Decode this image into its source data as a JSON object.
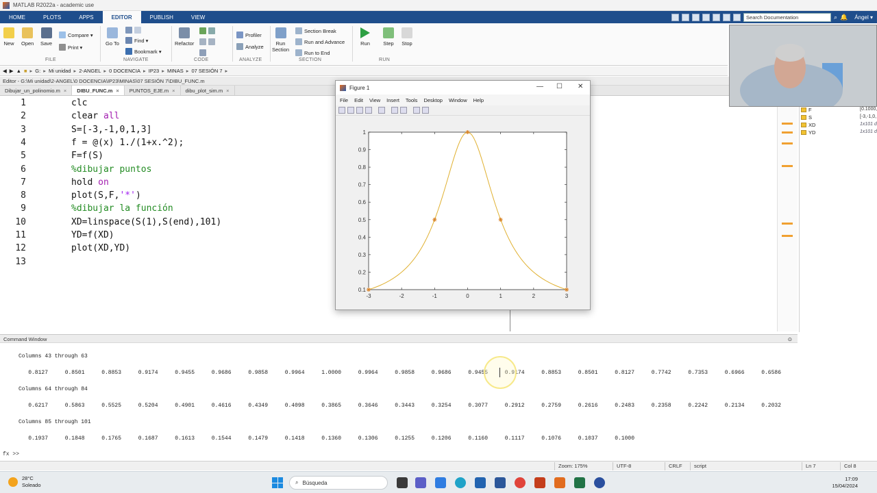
{
  "window": {
    "title": "MATLAB R2022a - academic use"
  },
  "ribbon_tabs": [
    "HOME",
    "PLOTS",
    "APPS",
    "EDITOR",
    "PUBLISH",
    "VIEW"
  ],
  "active_tab": "EDITOR",
  "search_placeholder": "Search Documentation",
  "user": "Ángel ▾",
  "ribbon": {
    "file": {
      "new": "New",
      "open": "Open",
      "save": "Save",
      "compare": "Compare ▾",
      "print": "Print ▾",
      "group": "FILE"
    },
    "navigate": {
      "goto": "Go To",
      "find": "Find ▾",
      "bookmark": "Bookmark ▾",
      "group": "NAVIGATE"
    },
    "code": {
      "refactor": "Refactor",
      "group": "CODE"
    },
    "analyze": {
      "profiler": "Profiler",
      "analyze": "Analyze",
      "group": "ANALYZE"
    },
    "section": {
      "run_section": "Run\nSection",
      "section_break": "Section Break",
      "run_advance": "Run and Advance",
      "run_end": "Run to End",
      "group": "SECTION"
    },
    "run": {
      "run": "Run",
      "step": "Step",
      "stop": "Stop",
      "group": "RUN"
    }
  },
  "address": [
    "G:",
    "Mi unidad",
    "2-ANGEL",
    "0 DOCENCIA",
    "IP23",
    "MINAS",
    "07 SESIÓN 7"
  ],
  "editor_header": "Editor - G:\\Mi unidad\\2-ANGEL\\0 DOCENCIA\\IP23\\MINAS\\07 SESIÓN 7\\DIBU_FUNC.m",
  "file_tabs": [
    {
      "name": "Dibujar_un_polinomio.m",
      "active": false
    },
    {
      "name": "DIBU_FUNC.m",
      "active": true
    },
    {
      "name": "PUNTOS_EJE.m",
      "active": false
    },
    {
      "name": "dibu_plot_sim.m",
      "active": false
    }
  ],
  "code_lines": [
    {
      "n": "1",
      "html": "clc"
    },
    {
      "n": "2",
      "html": "clear <span class='kw'>all</span>"
    },
    {
      "n": "3",
      "html": "S=[-3,-1,0,1,3]"
    },
    {
      "n": "4",
      "html": "f = @(x) 1./(1+x.^2);"
    },
    {
      "n": "5",
      "html": "F=f(S)"
    },
    {
      "n": "6",
      "html": "<span class='cm'>%dibujar puntos</span>"
    },
    {
      "n": "7",
      "html": "hold <span class='kw'>on</span>"
    },
    {
      "n": "8",
      "html": "plot(S,F,<span class='st'>'*'</span>)"
    },
    {
      "n": "9",
      "html": "<span class='cm'>%dibujar la función</span>"
    },
    {
      "n": "10",
      "html": "XD=linspace(S(1),S(end),101)"
    },
    {
      "n": "11",
      "html": "YD=f(XD)"
    },
    {
      "n": "12",
      "html": "plot(XD,YD)"
    },
    {
      "n": "13",
      "html": ""
    }
  ],
  "workspace": [
    {
      "name": "F",
      "value": "[0.1000,",
      "italic": false
    },
    {
      "name": "S",
      "value": "[-3,-1,0,",
      "italic": false
    },
    {
      "name": "XD",
      "value": "1x101 d",
      "italic": true
    },
    {
      "name": "YD",
      "value": "1x101 d",
      "italic": true
    }
  ],
  "figure": {
    "title": "Figure 1",
    "menu": [
      "File",
      "Edit",
      "View",
      "Insert",
      "Tools",
      "Desktop",
      "Window",
      "Help"
    ],
    "chart_data": {
      "type": "line",
      "x_ticks": [
        -3,
        -2,
        -1,
        0,
        1,
        2,
        3
      ],
      "y_ticks": [
        0.1,
        0.2,
        0.3,
        0.4,
        0.5,
        0.6,
        0.7,
        0.8,
        0.9,
        1
      ],
      "xlim": [
        -3,
        3
      ],
      "ylim": [
        0.1,
        1
      ],
      "series": [
        {
          "style": "line",
          "color": "#e0b030",
          "function": "1./(1+x.^2)",
          "samples": 101
        },
        {
          "style": "points",
          "color": "#d8832a",
          "x": [
            -3,
            -1,
            0,
            1,
            3
          ],
          "y": [
            0.1,
            0.5,
            1,
            0.5,
            0.1
          ]
        }
      ]
    }
  },
  "command_window": {
    "title": "Command Window",
    "blocks": [
      {
        "header": "Columns 43 through 63",
        "values": [
          "0.8127",
          "0.8501",
          "0.8853",
          "0.9174",
          "0.9455",
          "0.9686",
          "0.9858",
          "0.9964",
          "1.0000",
          "0.9964",
          "0.9858",
          "0.9686",
          "0.9455",
          "0.9174",
          "0.8853",
          "0.8501",
          "0.8127",
          "0.7742",
          "0.7353",
          "0.6966",
          "0.6586"
        ]
      },
      {
        "header": "Columns 64 through 84",
        "values": [
          "0.6217",
          "0.5863",
          "0.5525",
          "0.5204",
          "0.4901",
          "0.4616",
          "0.4349",
          "0.4098",
          "0.3865",
          "0.3646",
          "0.3443",
          "0.3254",
          "0.3077",
          "0.2912",
          "0.2759",
          "0.2616",
          "0.2483",
          "0.2358",
          "0.2242",
          "0.2134",
          "0.2032"
        ]
      },
      {
        "header": "Columns 85 through 101",
        "values": [
          "0.1937",
          "0.1848",
          "0.1765",
          "0.1687",
          "0.1613",
          "0.1544",
          "0.1479",
          "0.1418",
          "0.1360",
          "0.1306",
          "0.1255",
          "0.1206",
          "0.1160",
          "0.1117",
          "0.1076",
          "0.1037",
          "0.1000"
        ]
      }
    ],
    "prompt": "fx >>"
  },
  "status": {
    "zoom": "Zoom: 175%",
    "encoding": "UTF-8",
    "eol": "CRLF",
    "type": "script",
    "ln": "Ln  7",
    "col": "Col  8"
  },
  "taskbar": {
    "temp": "28°C",
    "weather": "Soleado",
    "search": "Búsqueda",
    "time": "17:09",
    "date": "15/04/2024"
  },
  "colors": {
    "ribbon_blue": "#1f4e8c",
    "marker_orange": "#f0a030",
    "plot_line": "#e0b030"
  }
}
